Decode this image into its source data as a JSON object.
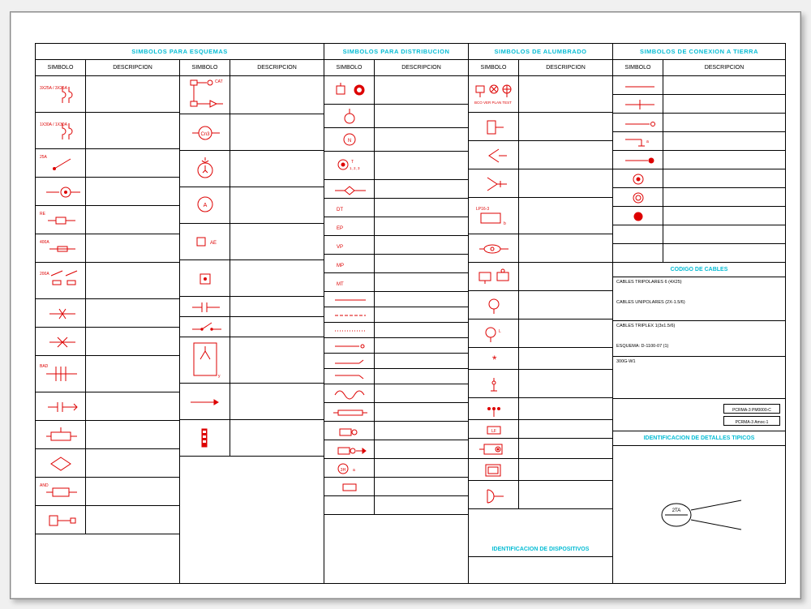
{
  "titles": {
    "esquemas": "SIMBOLOS PARA ESQUEMAS",
    "distribucion": "SIMBOLOS PARA DISTRIBUCION",
    "alumbrado": "SIMBOLOS DE ALUMBRADO",
    "tierra": "SIMBOLOS DE CONEXION A TIERRA",
    "cables": "CODIGO DE CABLES",
    "dispositivos": "IDENTIFICACION DE DISPOSITIVOS",
    "detalles": "IDENTIFICACION DE DETALLES TIPICOS"
  },
  "headers": {
    "simbolo": "SIMBOLO",
    "descripcion": "DESCRIPCION"
  },
  "col1": [
    {
      "lbl": "3X25A / 3X25A",
      "svg": "breaker-curve"
    },
    {
      "lbl": "1X30A / 1X30A",
      "svg": "breaker-curve"
    },
    {
      "lbl": "25A",
      "svg": "switch-slash"
    },
    {
      "lbl": "",
      "svg": "contact-circle"
    },
    {
      "lbl": "RE",
      "svg": "relay-box"
    },
    {
      "lbl": "400A",
      "svg": "fuse-rect"
    },
    {
      "lbl": "200A",
      "svg": "switch-fuse-pair"
    },
    {
      "lbl": "",
      "svg": "arrows-x"
    },
    {
      "lbl": "",
      "svg": "valve-x"
    },
    {
      "lbl": "BAD",
      "svg": "transformer-bars"
    },
    {
      "lbl": "",
      "svg": "capacitor-arrow"
    },
    {
      "lbl": "",
      "svg": "pushbutton-box"
    },
    {
      "lbl": "",
      "svg": "diamond"
    },
    {
      "lbl": "AND",
      "svg": "and-box"
    },
    {
      "lbl": "",
      "svg": "term-box"
    }
  ],
  "col2": [
    {
      "lbl": "CAT",
      "svg": "sch-block-1"
    },
    {
      "lbl": "Cn3",
      "svg": "circle-cn3"
    },
    {
      "lbl": "",
      "svg": "yy-circle"
    },
    {
      "lbl": "A",
      "svg": "circle-a"
    },
    {
      "lbl": "AE",
      "svg": "box-ae"
    },
    {
      "lbl": "",
      "svg": "box-dot"
    },
    {
      "lbl": "",
      "svg": "cap-h"
    },
    {
      "lbl": "",
      "svg": "switch-h"
    },
    {
      "lbl": "",
      "svg": "big-box-y"
    },
    {
      "lbl": "",
      "svg": "arrow-long"
    },
    {
      "lbl": "",
      "svg": "vertical-bars"
    }
  ],
  "col3": [
    {
      "lbl": "",
      "svg": "plug-fill"
    },
    {
      "lbl": "",
      "svg": "circle-stem"
    },
    {
      "lbl": "N",
      "svg": "circle-n"
    },
    {
      "lbl": "T 1,2,3",
      "svg": "circle-t"
    },
    {
      "lbl": "",
      "svg": "diamond-line"
    },
    {
      "lbl": "DT",
      "svg": ""
    },
    {
      "lbl": "EP",
      "svg": ""
    },
    {
      "lbl": "VP",
      "svg": ""
    },
    {
      "lbl": "MP",
      "svg": ""
    },
    {
      "lbl": "MT",
      "svg": ""
    },
    {
      "lbl": "",
      "svg": "line-plain"
    },
    {
      "lbl": "",
      "svg": "line-dashed"
    },
    {
      "lbl": "",
      "svg": "line-dot"
    },
    {
      "lbl": "",
      "svg": "line-arrow-dot"
    },
    {
      "lbl": "",
      "svg": "line-up"
    },
    {
      "lbl": "",
      "svg": "line-down"
    },
    {
      "lbl": "",
      "svg": "sine"
    },
    {
      "lbl": "",
      "svg": "bus-rect"
    },
    {
      "lbl": "",
      "svg": "cam-small"
    },
    {
      "lbl": "",
      "svg": "cam-arrow"
    },
    {
      "lbl": "3H",
      "svg": "circle-3h"
    },
    {
      "lbl": "",
      "svg": "rect-small"
    },
    {
      "lbl": "",
      "svg": ""
    }
  ],
  "col4": [
    {
      "lbl": "BCO VER PLAN TEST",
      "svg": "grp-fixtures"
    },
    {
      "lbl": "",
      "svg": "rect-open"
    },
    {
      "lbl": "",
      "svg": "speaker-l"
    },
    {
      "lbl": "",
      "svg": "speaker-r"
    },
    {
      "lbl": "LP16-3",
      "svg": "panel-lp"
    },
    {
      "lbl": "",
      "svg": "eye-switch"
    },
    {
      "lbl": "",
      "svg": "tv-pair"
    },
    {
      "lbl": "",
      "svg": "bulb"
    },
    {
      "lbl": "",
      "svg": "bulb-l"
    },
    {
      "lbl": "",
      "svg": "asterisk"
    },
    {
      "lbl": "",
      "svg": "ceiling"
    },
    {
      "lbl": "",
      "svg": "wall-dots"
    },
    {
      "lbl": "LF",
      "svg": "box-lf"
    },
    {
      "lbl": "",
      "svg": "box-eye"
    },
    {
      "lbl": "",
      "svg": "dbl-box"
    },
    {
      "lbl": "",
      "svg": "half-moon"
    }
  ],
  "tierra_rows": [
    {
      "svg": "ground-line"
    },
    {
      "svg": "ground-bar"
    },
    {
      "svg": "ground-arrow"
    },
    {
      "svg": "ground-tee"
    },
    {
      "svg": "ground-dot"
    },
    {
      "svg": "ground-ring"
    },
    {
      "svg": "ground-disc"
    },
    {
      "svg": "ground-fill"
    },
    {
      "svg": ""
    },
    {
      "svg": ""
    }
  ],
  "cables_text": [
    "CABLES TRIPOLARES 6 (4X25)",
    "CABLES UNIPOLARES (2X-1.5/6)",
    "CABLES TRIPLEX 1(3x1.5/6)",
    "ESQUEMA: D-1100-07 (1)",
    "300G-W1"
  ],
  "badge_labels": [
    "PCRMA-3 PM0000-C",
    "PCRMA-3 Amoc-1"
  ]
}
